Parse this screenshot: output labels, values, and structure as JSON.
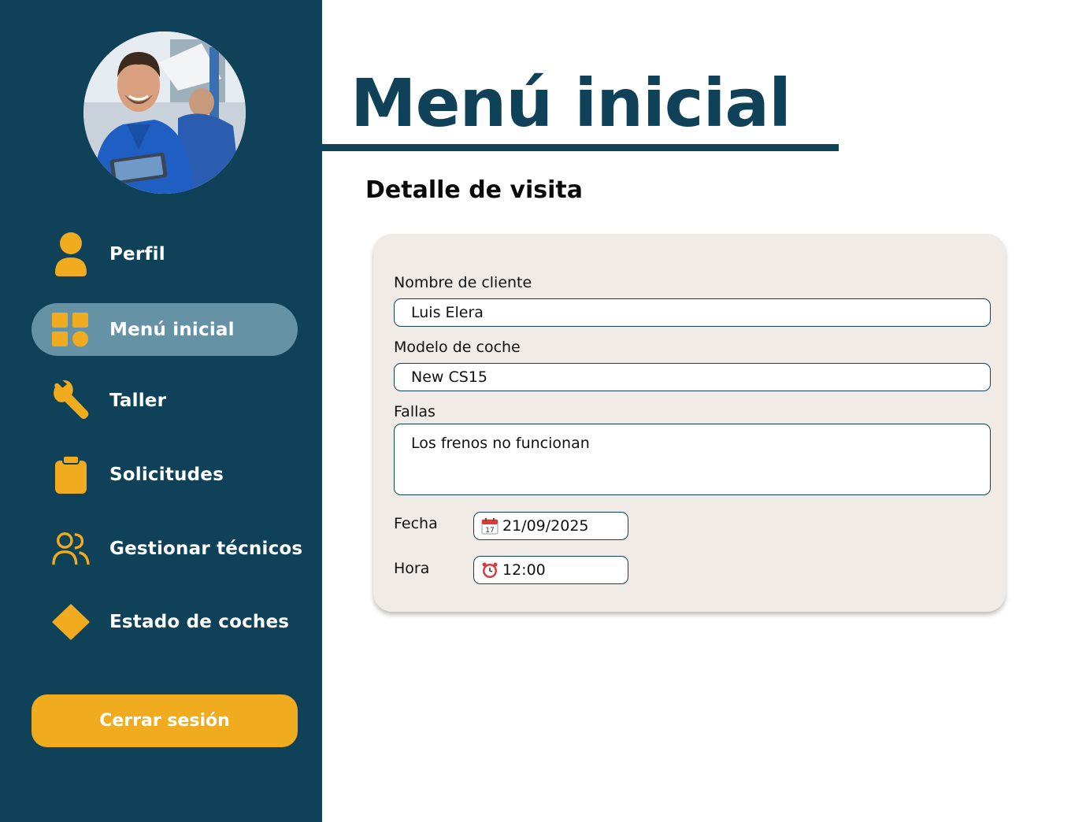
{
  "sidebar": {
    "avatar": "mechanic-profile-photo",
    "items": [
      {
        "label": "Perfil",
        "icon": "user-icon",
        "active": false
      },
      {
        "label": "Menú inicial",
        "icon": "grid-icon",
        "active": true
      },
      {
        "label": "Taller",
        "icon": "wrench-icon",
        "active": false
      },
      {
        "label": "Solicitudes",
        "icon": "clipboard-icon",
        "active": false
      },
      {
        "label": "Gestionar técnicos",
        "icon": "users-icon",
        "active": false
      },
      {
        "label": "Estado de coches",
        "icon": "diamond-icon",
        "active": false
      }
    ],
    "logout_label": "Cerrar sesión"
  },
  "main": {
    "title": "Menú inicial",
    "section_title": "Detalle de visita",
    "form": {
      "client_label": "Nombre de cliente",
      "client_value": "Luis Elera",
      "model_label": "Modelo de coche",
      "model_value": "New CS15",
      "faults_label": "Fallas",
      "faults_value": "Los frenos no funcionan",
      "date_label": "Fecha",
      "date_value": "21/09/2025",
      "date_icon": "calendar-icon",
      "time_label": "Hora",
      "time_value": "12:00",
      "time_icon": "alarm-clock-icon"
    }
  },
  "colors": {
    "sidebar_bg": "#0f4158",
    "active_item_bg": "#6593a5",
    "accent": "#f0ab1f",
    "card_bg": "#f0ebe7",
    "title": "#0f4158"
  }
}
